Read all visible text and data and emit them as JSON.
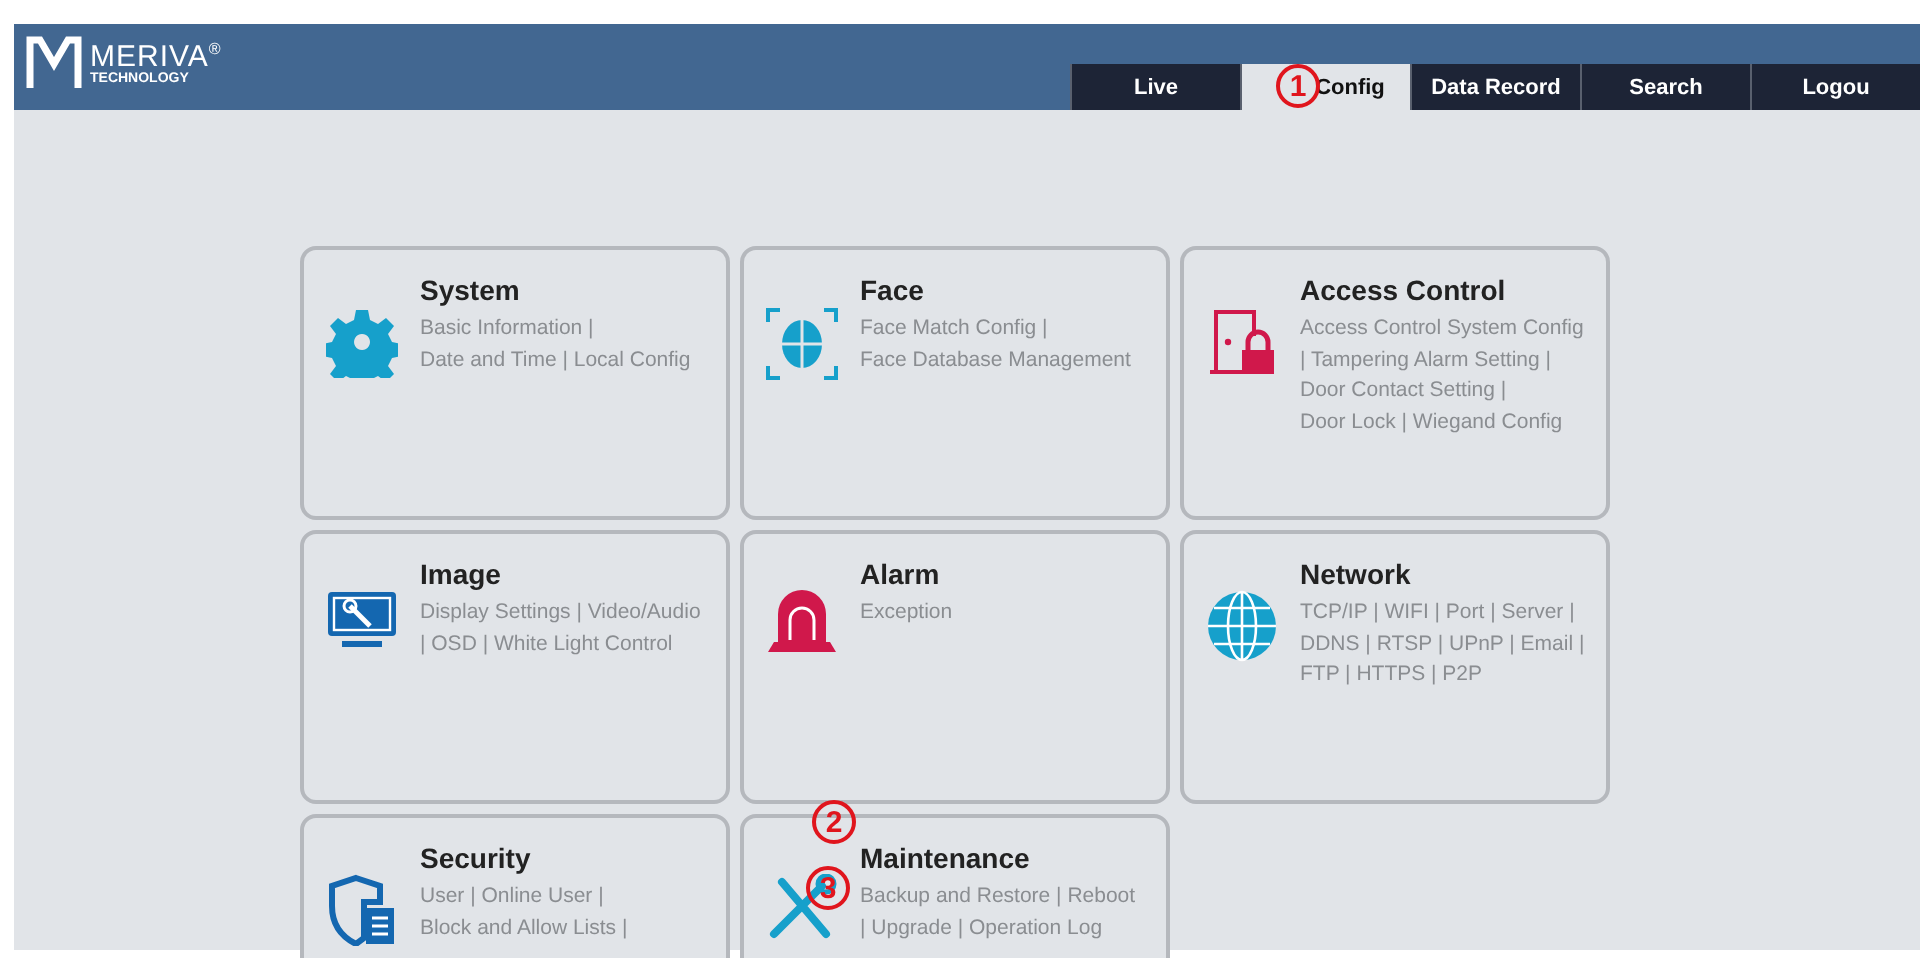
{
  "logo": {
    "brand": "MERIVA",
    "registered": "®",
    "tagline": "TECHNOLOGY"
  },
  "tabs": [
    {
      "label": "Live",
      "selected": false
    },
    {
      "label": "Config",
      "selected": true
    },
    {
      "label": "Data Record",
      "selected": false
    },
    {
      "label": "Search",
      "selected": false
    },
    {
      "label": "Logou",
      "selected": false
    }
  ],
  "cards": [
    {
      "kind": "gear",
      "title": "System",
      "lines": [
        "Basic Information |",
        "Date and Time | Local Config"
      ]
    },
    {
      "kind": "face",
      "title": "Face",
      "lines": [
        "Face Match Config |",
        "Face Database Management"
      ]
    },
    {
      "kind": "door",
      "title": "Access Control",
      "lines": [
        "Access Control System Config",
        "| Tampering Alarm Setting |",
        "Door Contact Setting |",
        "Door Lock | Wiegand Config"
      ]
    },
    {
      "kind": "monitor",
      "title": "Image",
      "lines": [
        "Display Settings | Video/Audio",
        "| OSD | White Light Control"
      ]
    },
    {
      "kind": "siren",
      "title": "Alarm",
      "lines": [
        "Exception"
      ]
    },
    {
      "kind": "globe",
      "title": "Network",
      "lines": [
        "TCP/IP | WIFI | Port | Server |",
        "DDNS | RTSP | UPnP | Email |",
        "FTP | HTTPS | P2P"
      ]
    },
    {
      "kind": "shield",
      "title": "Security",
      "lines": [
        "User | Online User |",
        "Block and Allow Lists |"
      ]
    },
    {
      "kind": "tools",
      "title": "Maintenance",
      "lines": [
        "Backup and Restore  | Reboot",
        "| Upgrade | Operation Log"
      ]
    }
  ],
  "callouts": [
    {
      "label": "1"
    },
    {
      "label": "2"
    },
    {
      "label": "3"
    }
  ]
}
